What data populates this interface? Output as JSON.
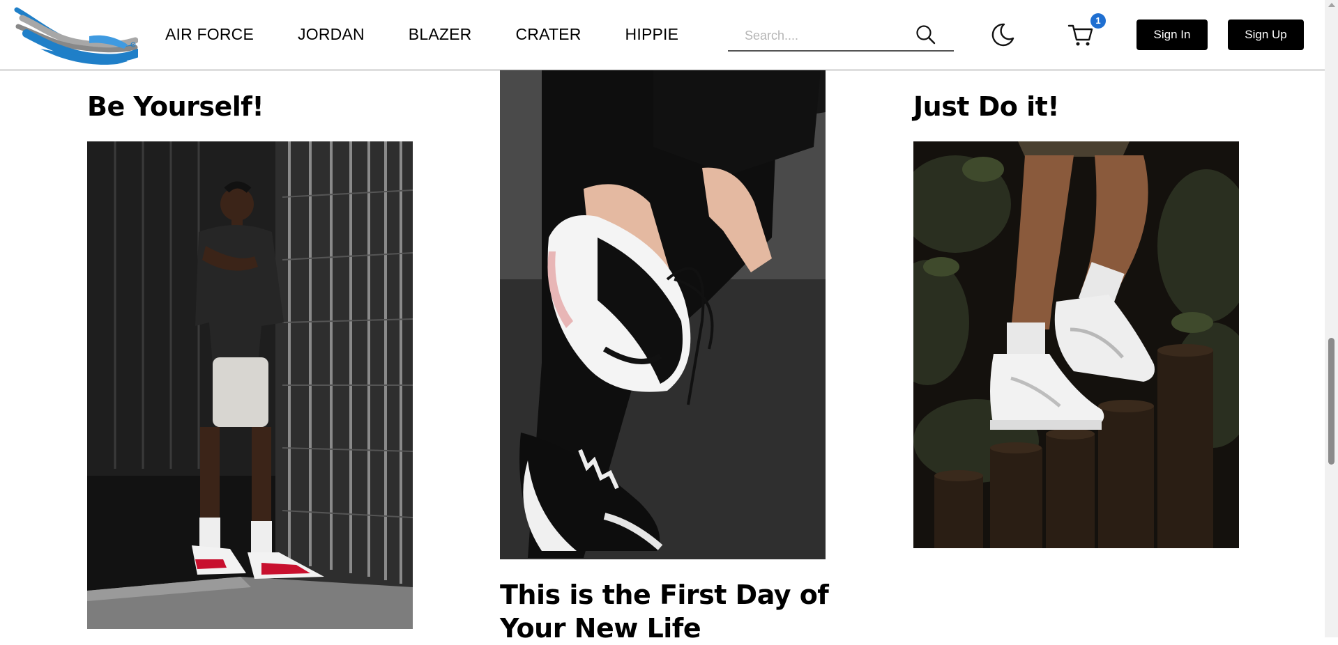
{
  "nav": {
    "items": [
      "AIR FORCE",
      "JORDAN",
      "BLAZER",
      "CRATER",
      "HIPPIE"
    ]
  },
  "search": {
    "placeholder": "Search...."
  },
  "cart": {
    "count": "1"
  },
  "auth": {
    "sign_in": "Sign In",
    "sign_up": "Sign Up"
  },
  "cards": [
    {
      "title": "Be Yourself!"
    },
    {
      "title": "This is the First Day of Your New Life"
    },
    {
      "title": "Just Do it!"
    }
  ],
  "icons": {
    "logo": "flying-shoe-logo",
    "search": "search-icon",
    "theme": "moon-icon",
    "cart": "cart-icon"
  },
  "colors": {
    "logo_blue": "#1f7fc8",
    "logo_gray": "#9a9a9a",
    "badge": "#1f6fd1",
    "button": "#000000"
  }
}
